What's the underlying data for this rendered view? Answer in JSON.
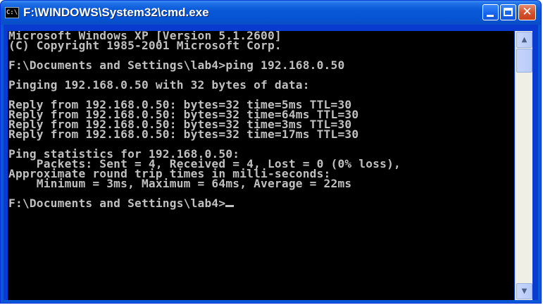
{
  "window": {
    "title": "F:\\WINDOWS\\System32\\cmd.exe",
    "icon_label": "C:\\"
  },
  "titlebar_buttons": {
    "minimize": "_",
    "maximize": "□",
    "close": "✕"
  },
  "console": {
    "lines": [
      "Microsoft Windows XP [Version 5.1.2600]",
      "(C) Copyright 1985-2001 Microsoft Corp.",
      "",
      "F:\\Documents and Settings\\lab4>ping 192.168.0.50",
      "",
      "Pinging 192.168.0.50 with 32 bytes of data:",
      "",
      "Reply from 192.168.0.50: bytes=32 time=5ms TTL=30",
      "Reply from 192.168.0.50: bytes=32 time=64ms TTL=30",
      "Reply from 192.168.0.50: bytes=32 time=3ms TTL=30",
      "Reply from 192.168.0.50: bytes=32 time=17ms TTL=30",
      "",
      "Ping statistics for 192.168.0.50:",
      "    Packets: Sent = 4, Received = 4, Lost = 0 (0% loss),",
      "Approximate round trip times in milli-seconds:",
      "    Minimum = 3ms, Maximum = 64ms, Average = 22ms",
      "",
      "F:\\Documents and Settings\\lab4>"
    ]
  },
  "scrollbar": {
    "up_arrow": "▲",
    "down_arrow": "▼"
  }
}
